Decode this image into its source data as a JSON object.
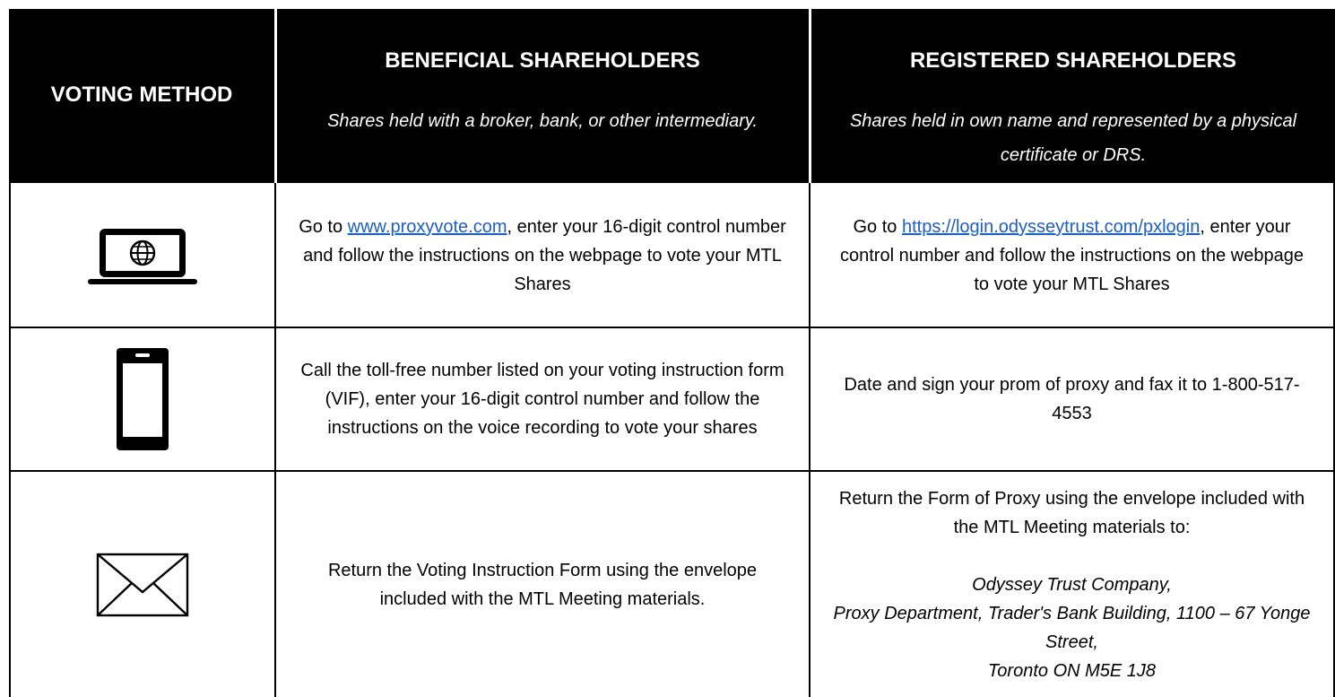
{
  "header": {
    "voting_method": "VOTING METHOD",
    "beneficial": {
      "title": "BENEFICIAL SHAREHOLDERS",
      "subtitle": "Shares held with a broker, bank, or other intermediary."
    },
    "registered": {
      "title": "REGISTERED SHAREHOLDERS",
      "subtitle": "Shares held in own name and represented by a physical certificate or DRS."
    }
  },
  "rows": [
    {
      "icon": "laptop-globe-icon",
      "beneficial": {
        "pre": "Go to ",
        "link": "www.proxyvote.com",
        "post": ", enter your 16-digit control number and follow the instructions on the webpage to vote your MTL Shares"
      },
      "registered": {
        "pre": "Go to ",
        "link": "https://login.odysseytrust.com/pxlogin",
        "post": ", enter your control number and follow the instructions on the webpage to vote your MTL Shares"
      }
    },
    {
      "icon": "phone-icon",
      "beneficial": {
        "text": "Call the toll-free number listed on your voting instruction form (VIF), enter your 16-digit control number and follow the instructions on the voice recording to vote your shares"
      },
      "registered": {
        "text": "Date and sign your prom of proxy and fax it to 1-800-517-4553"
      }
    },
    {
      "icon": "envelope-icon",
      "beneficial": {
        "text": "Return the Voting Instruction Form using the envelope included with the MTL Meeting materials."
      },
      "registered": {
        "text": "Return the Form of Proxy using the envelope included with the MTL Meeting materials to:",
        "address_line1": "Odyssey Trust Company,",
        "address_line2": "Proxy Department, Trader's Bank Building, 1100 – 67 Yonge Street,",
        "address_line3": "Toronto ON M5E 1J8"
      }
    }
  ],
  "colors": {
    "header_bg": "#000000",
    "header_text": "#ffffff",
    "link": "#1f5fbf"
  }
}
